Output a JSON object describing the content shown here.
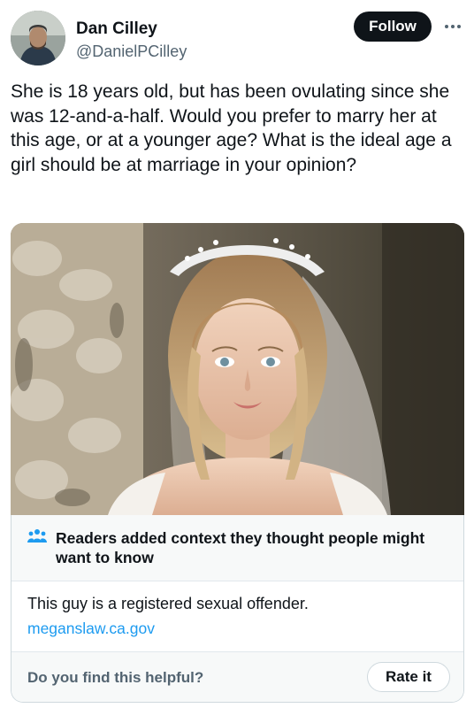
{
  "author": {
    "display_name": "Dan Cilley",
    "handle": "@DanielPCilley",
    "follow_label": "Follow",
    "avatar_icon": "profile-photo"
  },
  "tweet": {
    "text": "She is 18 years old, but has been ovulating since she was 12-and-a-half.  Would you prefer to marry her at this age, or at a younger age?  What is the ideal age a girl should be at marriage in your opinion?",
    "media_icon": "bride-portrait-image"
  },
  "community_note": {
    "title": "Readers added context they thought people might want to know",
    "body": "This guy is a registered sexual offender.",
    "link": "meganslaw.ca.gov",
    "question": "Do you find this helpful?",
    "rate_label": "Rate it",
    "icon": "people-icon"
  },
  "colors": {
    "text": "#0f1419",
    "secondary": "#536471",
    "link": "#1d9bf0",
    "note_accent": "#1d9bf0"
  }
}
